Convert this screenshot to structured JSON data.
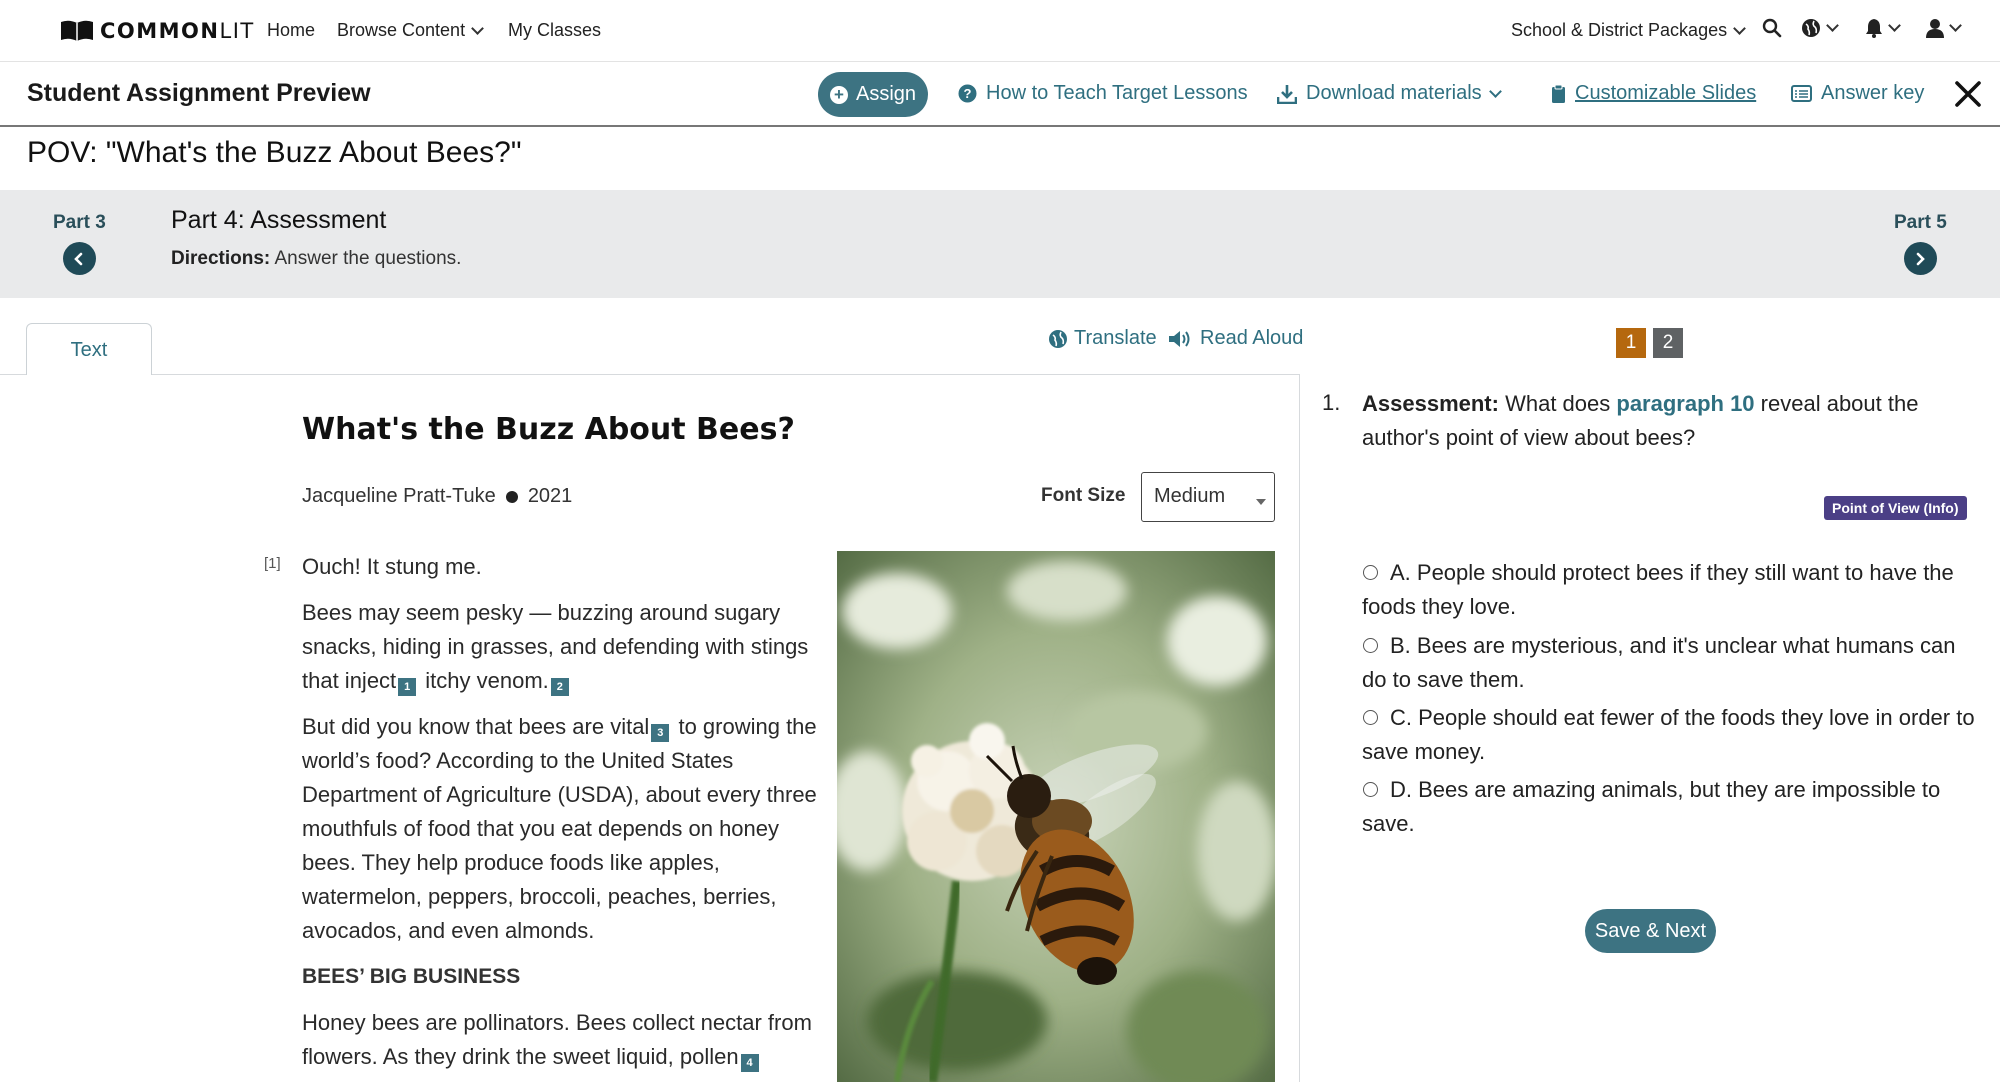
{
  "topnav": {
    "logo_text_bold": "COMMON",
    "logo_text_light": "LIT",
    "home": "Home",
    "browse": "Browse Content",
    "classes": "My Classes",
    "packages": "School & District Packages"
  },
  "toolbar": {
    "title": "Student Assignment Preview",
    "assign": "Assign",
    "how_to_teach": "How to Teach Target Lessons",
    "download": "Download materials",
    "slides": "Customizable Slides",
    "answer_key": "Answer key"
  },
  "lesson": {
    "title": "POV: \"What's the Buzz About Bees?\""
  },
  "part": {
    "prev_label": "Part 3",
    "next_label": "Part 5",
    "heading": "Part 4: Assessment",
    "directions_label": "Directions:",
    "directions_text": "Answer the questions."
  },
  "reader": {
    "tab_label": "Text",
    "translate": "Translate",
    "read_aloud": "Read Aloud",
    "article_title": "What's the Buzz About Bees?",
    "author": "Jacqueline Pratt-Tuke",
    "year": "2021",
    "font_size_label": "Font Size",
    "font_size_value": "Medium",
    "para_number": "[1]",
    "p1": "Ouch! It stung me.",
    "p2a": "Bees may seem pesky — buzzing around sugary snacks, hiding in grasses, and defending with stings that inject",
    "p2b": "itchy venom.",
    "p3a": "But did you know that bees are vital",
    "p3b": "to growing the world’s food? According to the United States Department of Agriculture (USDA), about every three mouthfuls of food that you eat depends on honey bees. They help produce foods like apples, watermelon, peppers, broccoli, peaches, berries, avocados, and even almonds.",
    "subheading": "BEES’ BIG BUSINESS",
    "p4a": "Honey bees are pollinators. Bees collect nectar from flowers. As they drink the sweet liquid, pollen",
    "footnotes": [
      "1",
      "2",
      "3",
      "4"
    ]
  },
  "questions": {
    "tabs": [
      "1",
      "2"
    ],
    "number": "1.",
    "label": "Assessment:",
    "text_before": "What does",
    "highlight": "paragraph 10",
    "text_after": "reveal about the author's point of view about bees?",
    "skill": "Point of View (Info)",
    "choices": [
      "A. People should protect bees if they still want to have the foods they love.",
      "B. Bees are mysterious, and it's unclear what humans can do to save them.",
      "C. People should eat fewer of the foods they love in order to save money.",
      "D. Bees are amazing animals, but they are impossible to save."
    ],
    "save_next": "Save & Next"
  },
  "colors": {
    "teal": "#3d7382",
    "dark_teal": "#1f4a57",
    "active_q": "#b5680e",
    "inactive_q": "#5f6264",
    "badge": "#4b3f86",
    "banner_bg": "#e9eaeb"
  }
}
